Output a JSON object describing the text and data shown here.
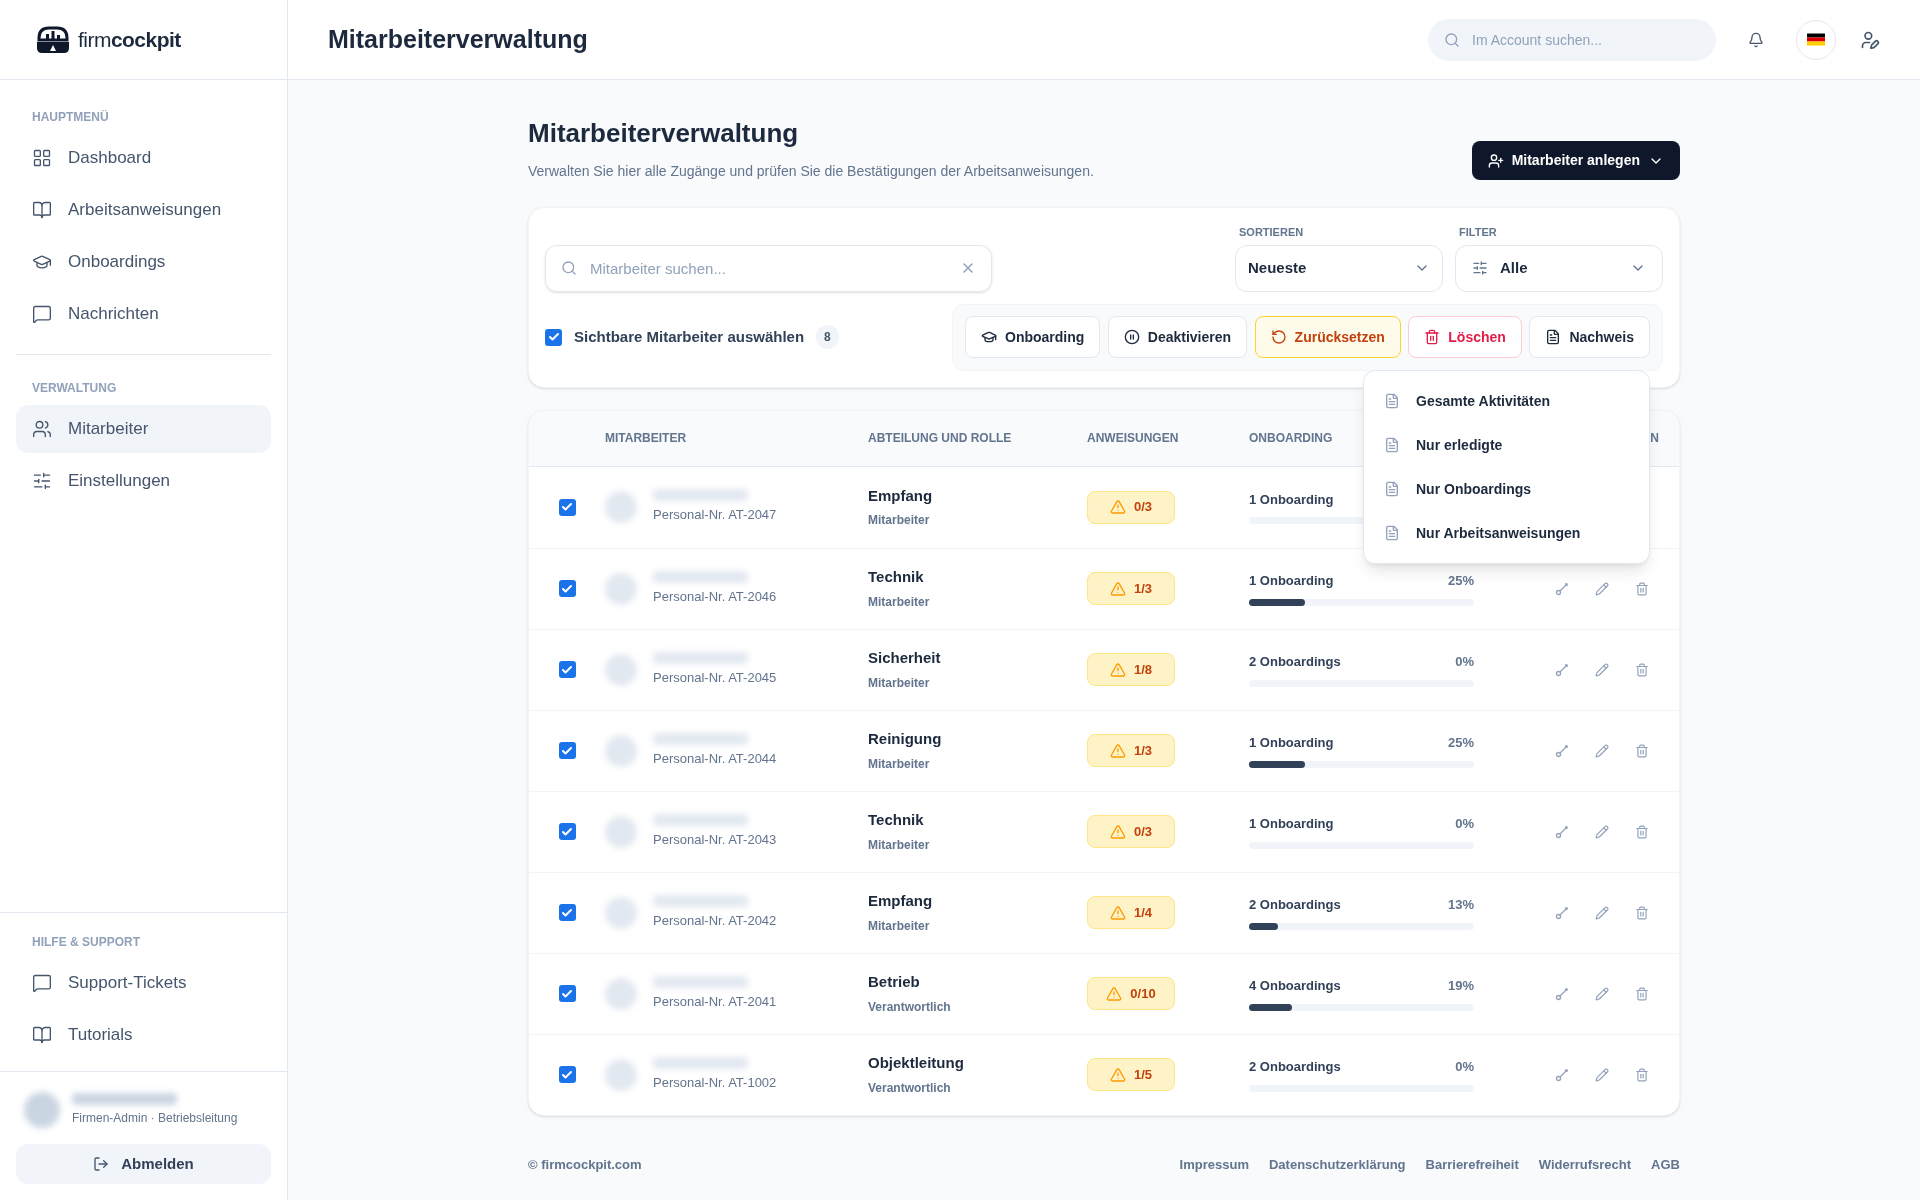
{
  "brand": {
    "name": "firm**cockpit**"
  },
  "sidebar": {
    "sections": [
      {
        "title": "HAUPTMENÜ",
        "items": [
          {
            "label": "Dashboard",
            "kind": "grid",
            "selected": false
          },
          {
            "label": "Arbeitsanweisungen",
            "kind": "book",
            "selected": false
          },
          {
            "label": "Onboardings",
            "kind": "cap",
            "selected": false
          },
          {
            "label": "Nachrichten",
            "kind": "chat",
            "selected": false
          }
        ]
      },
      {
        "title": "VERWALTUNG",
        "items": [
          {
            "label": "Mitarbeiter",
            "kind": "users",
            "selected": true
          },
          {
            "label": "Einstellungen",
            "kind": "sliders",
            "selected": false
          }
        ]
      }
    ],
    "support": {
      "title": "HILFE & SUPPORT",
      "items": [
        {
          "label": "Support-Tickets",
          "kind": "chat",
          "selected": false
        },
        {
          "label": "Tutorials",
          "kind": "book",
          "selected": false
        }
      ]
    },
    "user": {
      "role": "Firmen-Admin · Betriebsleitung"
    },
    "logout": "Abmelden"
  },
  "header": {
    "title": "Mitarbeiterverwaltung",
    "search": {
      "placeholder": "Im Account suchen..."
    }
  },
  "page": {
    "title": "Mitarbeiterverwaltung",
    "subtitle": "Verwalten Sie hier alle Zugänge und prüfen Sie die Bestätigungen der Arbeitsanweisungen.",
    "create_button": "Mitarbeiter anlegen"
  },
  "toolbar": {
    "search": {
      "placeholder": "Mitarbeiter suchen..."
    },
    "sort": {
      "label": "SORTIEREN",
      "value": "Neueste"
    },
    "filter": {
      "label": "FILTER",
      "value": "Alle"
    },
    "select_all": {
      "label": "Sichtbare Mitarbeiter auswählen",
      "checked": true,
      "count": "8"
    },
    "actions": [
      {
        "label": "Onboarding",
        "kind": "cap"
      },
      {
        "label": "Deaktivieren",
        "kind": "pause"
      },
      {
        "label": "Zurücksetzen",
        "kind": "reset"
      },
      {
        "label": "Löschen",
        "kind": "trash"
      },
      {
        "label": "Nachweis",
        "kind": "file"
      }
    ]
  },
  "dropdown": {
    "items": [
      "Gesamte Aktivitäten",
      "Nur erledigte",
      "Nur Onboardings",
      "Nur Arbeitsanweisungen"
    ]
  },
  "table": {
    "columns": [
      "MITARBEITER",
      "ABTEILUNG UND ROLLE",
      "ANWEISUNGEN",
      "ONBOARDING",
      "N"
    ],
    "rows": [
      {
        "checked": true,
        "personnel": "Personal-Nr. AT-2047",
        "department": "Empfang",
        "role": "Mitarbeiter",
        "instructions": "0/3",
        "onboarding": "1 Onboarding",
        "actions_visible": false
      },
      {
        "checked": true,
        "personnel": "Personal-Nr. AT-2046",
        "department": "Technik",
        "role": "Mitarbeiter",
        "instructions": "1/3",
        "onboarding": "1 Onboarding",
        "percent": "25%",
        "level": 0.25,
        "actions_visible": true
      },
      {
        "checked": true,
        "personnel": "Personal-Nr. AT-2045",
        "department": "Sicherheit",
        "role": "Mitarbeiter",
        "instructions": "1/8",
        "onboarding": "2 Onboardings",
        "percent": "0%",
        "level": 0,
        "actions_visible": true
      },
      {
        "checked": true,
        "personnel": "Personal-Nr. AT-2044",
        "department": "Reinigung",
        "role": "Mitarbeiter",
        "instructions": "1/3",
        "onboarding": "1 Onboarding",
        "percent": "25%",
        "level": 0.25,
        "actions_visible": true
      },
      {
        "checked": true,
        "personnel": "Personal-Nr. AT-2043",
        "department": "Technik",
        "role": "Mitarbeiter",
        "instructions": "0/3",
        "onboarding": "1 Onboarding",
        "percent": "0%",
        "level": 0,
        "actions_visible": true
      },
      {
        "checked": true,
        "personnel": "Personal-Nr. AT-2042",
        "department": "Empfang",
        "role": "Mitarbeiter",
        "instructions": "1/4",
        "onboarding": "2 Onboardings",
        "percent": "13%",
        "level": 0.13,
        "actions_visible": true
      },
      {
        "checked": true,
        "personnel": "Personal-Nr. AT-2041",
        "department": "Betrieb",
        "role": "Verantwortlich",
        "instructions": "0/10",
        "onboarding": "4 Onboardings",
        "percent": "19%",
        "level": 0.19,
        "actions_visible": true
      },
      {
        "checked": true,
        "personnel": "Personal-Nr. AT-1002",
        "department": "Objektleitung",
        "role": "Verantwortlich",
        "instructions": "1/5",
        "onboarding": "2 Onboardings",
        "percent": "0%",
        "level": 0,
        "actions_visible": true
      }
    ]
  },
  "footer": {
    "copyright": "© firmcockpit.com",
    "links": [
      "Impressum",
      "Datenschutzerklärung",
      "Barrierefreiheit",
      "Widerrufsrecht",
      "AGB"
    ]
  }
}
